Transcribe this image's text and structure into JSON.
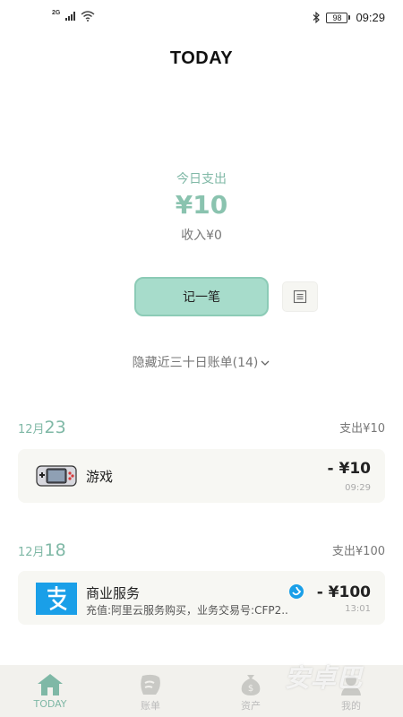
{
  "status_bar": {
    "network": "2G",
    "battery": "98",
    "time": "09:29"
  },
  "header": {
    "title": "TODAY"
  },
  "summary": {
    "label": "今日支出",
    "amount": "¥10",
    "income": "收入¥0"
  },
  "actions": {
    "record_label": "记一笔",
    "history_toggle": "隐藏近三十日账单(14)"
  },
  "days": [
    {
      "month": "12月",
      "day": "23",
      "total": "支出¥10",
      "entries": [
        {
          "title": "游戏",
          "amount": "- ¥10",
          "time": "09:29",
          "icon": "game-console-icon"
        }
      ]
    },
    {
      "month": "12月",
      "day": "18",
      "total": "支出¥100",
      "entries": [
        {
          "title": "商业服务",
          "description": "充值:阿里云服务购买，业务交易号:CFP2..",
          "amount": "- ¥100",
          "time": "13:01",
          "icon": "alipay-icon"
        }
      ]
    }
  ],
  "nav": [
    {
      "label": "TODAY",
      "icon": "home-icon",
      "active": true
    },
    {
      "label": "账单",
      "icon": "bill-icon",
      "active": false
    },
    {
      "label": "资产",
      "icon": "money-bag-icon",
      "active": false
    },
    {
      "label": "我的",
      "icon": "profile-icon",
      "active": false
    }
  ],
  "watermark": "安卓巴",
  "colors": {
    "accent": "#8ac3af",
    "button": "#a7dccb",
    "card": "#f7f7f3",
    "nav_bg": "#f2f1ed",
    "alipay": "#1a9fe8"
  }
}
